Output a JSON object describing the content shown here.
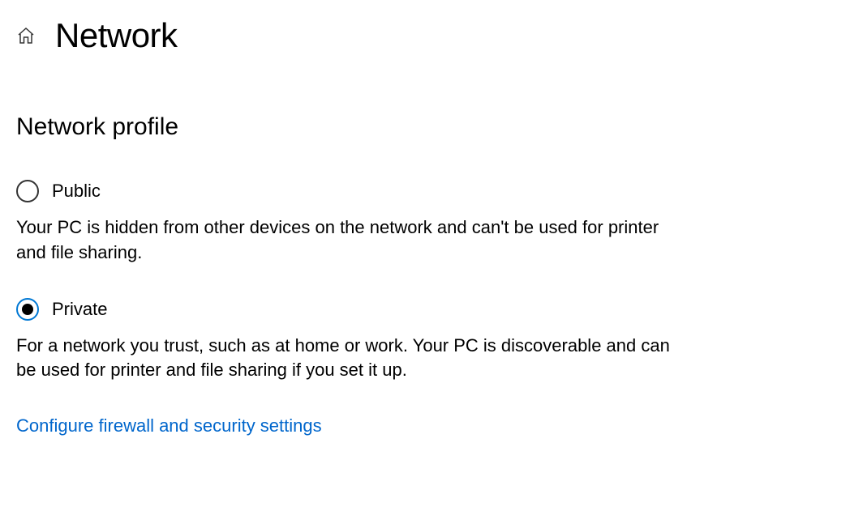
{
  "header": {
    "title": "Network"
  },
  "section": {
    "heading": "Network profile"
  },
  "options": {
    "public": {
      "label": "Public",
      "description": "Your PC is hidden from other devices on the network and can't be used for printer and file sharing.",
      "selected": false
    },
    "private": {
      "label": "Private",
      "description": "For a network you trust, such as at home or work. Your PC is discoverable and can be used for printer and file sharing if you set it up.",
      "selected": true
    }
  },
  "link": {
    "firewall_label": "Configure firewall and security settings"
  }
}
